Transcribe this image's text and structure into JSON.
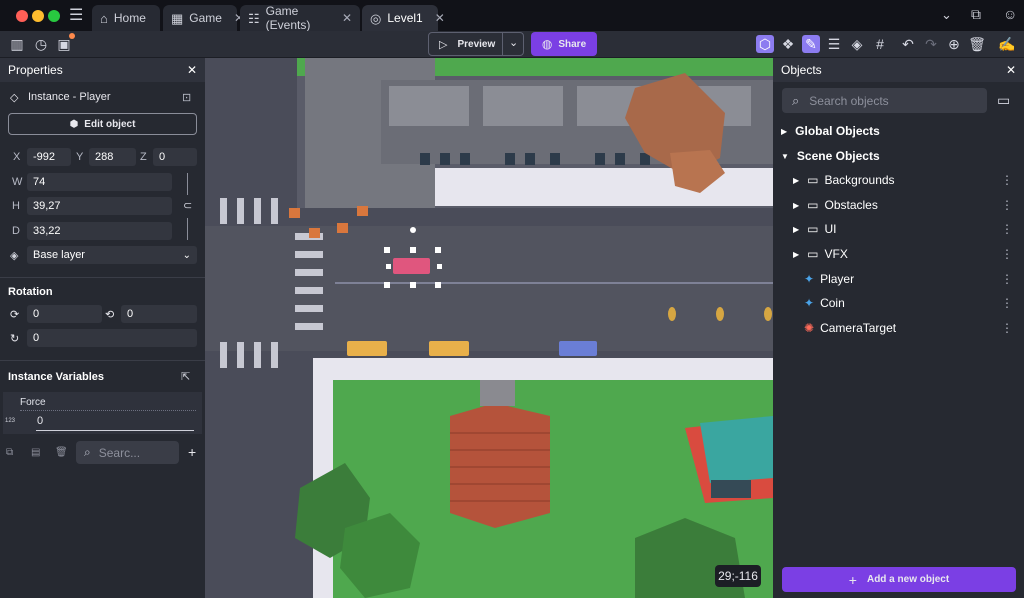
{
  "tabs": [
    {
      "label": "Home",
      "icon": "home-icon"
    },
    {
      "label": "Game",
      "icon": "film-icon"
    },
    {
      "label": "Game (Events)",
      "icon": "events-icon"
    },
    {
      "label": "Level1",
      "icon": "scene-icon"
    }
  ],
  "toolbar": {
    "preview_label": "Preview",
    "share_label": "Share",
    "accent": "#7b3fe4"
  },
  "properties": {
    "title": "Properties",
    "instance_label": "Instance  -  Player",
    "edit_object_label": "Edit object",
    "x_label": "X",
    "x_value": "-992",
    "y_label": "Y",
    "y_value": "288",
    "z_label": "Z",
    "z_value": "0",
    "w_label": "W",
    "w_value": "74",
    "h_label": "H",
    "h_value": "39,27",
    "d_label": "D",
    "d_value": "33,22",
    "layer_value": "Base layer",
    "rotation_title": "Rotation",
    "rot1": "0",
    "rot2": "0",
    "rot3": "0",
    "instance_vars_title": "Instance Variables",
    "var_name": "Force",
    "var_type": "123",
    "var_value": "0",
    "search_placeholder": "Searc..."
  },
  "canvas": {
    "coords": "29;-116"
  },
  "objects": {
    "title": "Objects",
    "search_placeholder": "Search objects",
    "global_label": "Global Objects",
    "scene_label": "Scene Objects",
    "folders": [
      "Backgrounds",
      "Obstacles",
      "UI",
      "VFX"
    ],
    "items": [
      "Player",
      "Coin",
      "CameraTarget"
    ],
    "add_label": "Add a new object"
  }
}
